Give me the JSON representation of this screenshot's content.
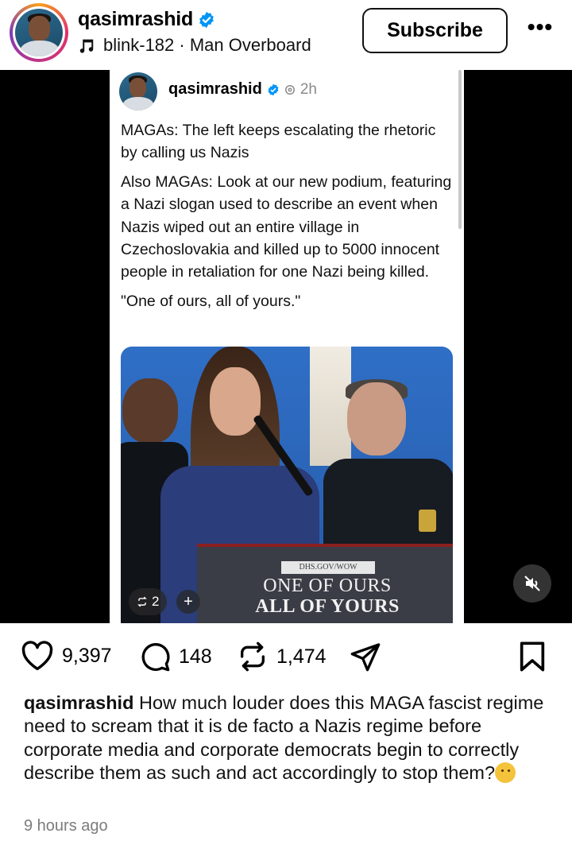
{
  "header": {
    "username": "qasimrashid",
    "music": "blink-182 · Man Overboard",
    "subscribe_label": "Subscribe",
    "more_label": "•••"
  },
  "embedded_post": {
    "username": "qasimrashid",
    "time": "2h",
    "paragraphs": [
      "MAGAs: The left keeps escalating the rhetoric by calling us Nazis",
      "Also MAGAs: Look at our new podium, featuring a Nazi slogan used to describe an event when Nazis wiped out an entire village in Czechoslovakia and killed up to 5000 innocent people in retaliation for one Nazi being killed.",
      "\"One of ours, all of yours.\""
    ],
    "photo": {
      "podium_url": "DHS.GOV/WOW",
      "podium_line1": "ONE OF OURS",
      "podium_line2": "ALL OF YOURS"
    },
    "repost_count": "2",
    "plus_label": "+"
  },
  "actions": {
    "likes": "9,397",
    "comments": "148",
    "reposts": "1,474"
  },
  "caption": {
    "username": "qasimrashid",
    "text": " How much louder does this MAGA fascist regime need to scream that it is de facto a Nazis regime before corporate media and corporate democrats begin to correctly describe them as such and act accordingly to stop them?"
  },
  "timestamp": "9 hours ago",
  "icons": [
    "verified-icon",
    "music-note-icon",
    "heart-icon",
    "comment-icon",
    "repost-icon",
    "share-icon",
    "bookmark-icon",
    "mute-icon",
    "thinking-emoji"
  ],
  "colors": {
    "verified": "#0095f6",
    "ring": "#e1306c"
  }
}
